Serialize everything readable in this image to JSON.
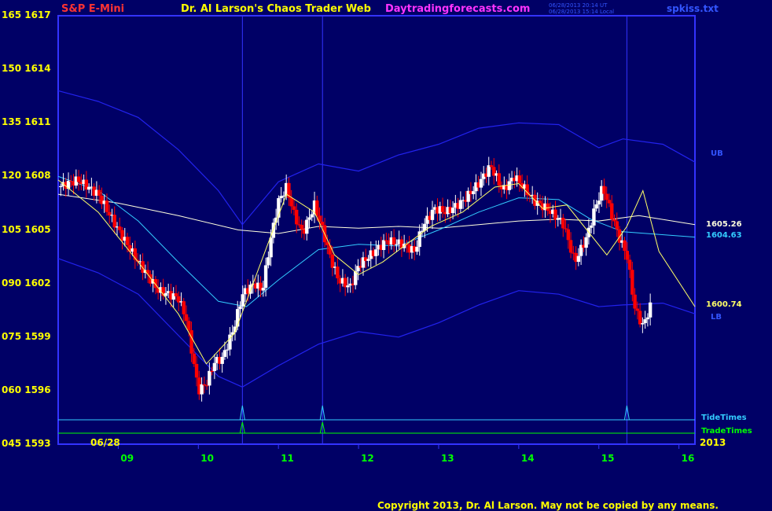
{
  "header": {
    "instrument": "S&P E-Mini",
    "title": "Dr. Al Larson's Chaos Trader Web",
    "site": "Daytradingforecasts.com",
    "timestamp_utc": "06/28/2013 20:14 UT",
    "timestamp_local": "06/28/2013 15:14 Local",
    "filename": "spkiss.txt"
  },
  "footer": {
    "copyright": "Copyright 2013, Dr. Al Larson. May not be copied by any means."
  },
  "colors": {
    "background": "#000066",
    "frame": "#3333ff",
    "up_bar": "#ffffff",
    "down_bar": "#ff0000",
    "band": "#2222ee",
    "cyan_ma": "#33ccff",
    "yellow_ma": "#ffff66",
    "long_ma": "#ffffdd",
    "tide": "#33ccff",
    "trade": "#00ff00"
  },
  "chart_data": {
    "type": "candlestick",
    "ylim": [
      1593,
      1617
    ],
    "y_ticks": [
      {
        "left": "165",
        "right": "1617",
        "value": 1617
      },
      {
        "left": "150",
        "right": "1614",
        "value": 1614
      },
      {
        "left": "135",
        "right": "1611",
        "value": 1611
      },
      {
        "left": "120",
        "right": "1608",
        "value": 1608
      },
      {
        "left": "105",
        "right": "1605",
        "value": 1605
      },
      {
        "left": "090",
        "right": "1602",
        "value": 1602
      },
      {
        "left": "075",
        "right": "1599",
        "value": 1599
      },
      {
        "left": "060",
        "right": "1596",
        "value": 1596
      },
      {
        "left": "045",
        "right": "1593",
        "value": 1593
      }
    ],
    "xlim": [
      8.25,
      16.2
    ],
    "x_ticks": [
      {
        "label": "09",
        "value": 9
      },
      {
        "label": "10",
        "value": 10
      },
      {
        "label": "11",
        "value": 11
      },
      {
        "label": "12",
        "value": 12
      },
      {
        "label": "13",
        "value": 13
      },
      {
        "label": "14",
        "value": 14
      },
      {
        "label": "15",
        "value": 15
      },
      {
        "label": "16",
        "value": 16
      }
    ],
    "date_label": "06/28",
    "year_label": "2013",
    "vertical_lines": [
      10.55,
      11.55,
      15.35
    ],
    "tide_times": [
      10.55,
      11.55,
      15.35
    ],
    "trade_times": [
      10.55,
      11.55
    ],
    "tide_label": "TideTimes",
    "trade_label": "TradeTimes",
    "band_labels": {
      "upper": "UB",
      "lower": "LB"
    },
    "value_labels": [
      {
        "text": "1605.26",
        "value": 1605.26,
        "color": "#ffffdd"
      },
      {
        "text": "1604.63",
        "value": 1604.63,
        "color": "#33ccff"
      },
      {
        "text": "1600.74",
        "value": 1600.74,
        "color": "#ffff66"
      }
    ],
    "series": {
      "close": [
        [
          8.25,
          1607.4
        ],
        [
          8.5,
          1607.8
        ],
        [
          8.75,
          1607.0
        ],
        [
          9.0,
          1605.0
        ],
        [
          9.25,
          1603.2
        ],
        [
          9.5,
          1601.6
        ],
        [
          9.75,
          1601.2
        ],
        [
          9.85,
          1600.0
        ],
        [
          10.0,
          1596.0
        ],
        [
          10.1,
          1596.4
        ],
        [
          10.2,
          1597.6
        ],
        [
          10.3,
          1597.8
        ],
        [
          10.45,
          1599.6
        ],
        [
          10.55,
          1601.4
        ],
        [
          10.7,
          1602.0
        ],
        [
          10.8,
          1601.6
        ],
        [
          10.9,
          1604.4
        ],
        [
          11.0,
          1606.6
        ],
        [
          11.1,
          1607.4
        ],
        [
          11.2,
          1605.8
        ],
        [
          11.3,
          1604.8
        ],
        [
          11.45,
          1606.4
        ],
        [
          11.55,
          1605.0
        ],
        [
          11.65,
          1603.4
        ],
        [
          11.75,
          1602.2
        ],
        [
          11.9,
          1601.8
        ],
        [
          12.0,
          1603.0
        ],
        [
          12.15,
          1603.6
        ],
        [
          12.35,
          1604.4
        ],
        [
          12.55,
          1604.2
        ],
        [
          12.7,
          1603.8
        ],
        [
          12.8,
          1605.2
        ],
        [
          12.95,
          1606.2
        ],
        [
          13.1,
          1606.0
        ],
        [
          13.3,
          1606.6
        ],
        [
          13.5,
          1607.6
        ],
        [
          13.65,
          1608.6
        ],
        [
          13.8,
          1607.2
        ],
        [
          13.95,
          1608.0
        ],
        [
          14.2,
          1606.6
        ],
        [
          14.35,
          1606.2
        ],
        [
          14.55,
          1605.4
        ],
        [
          14.7,
          1603.2
        ],
        [
          14.85,
          1604.6
        ],
        [
          14.95,
          1606.2
        ],
        [
          15.05,
          1607.4
        ],
        [
          15.15,
          1606.0
        ],
        [
          15.25,
          1604.6
        ],
        [
          15.35,
          1603.6
        ],
        [
          15.45,
          1600.6
        ],
        [
          15.55,
          1599.6
        ],
        [
          15.65,
          1600.8
        ]
      ],
      "cyan_ma": [
        [
          8.25,
          1608.0
        ],
        [
          8.75,
          1607.2
        ],
        [
          9.25,
          1605.5
        ],
        [
          9.75,
          1603.2
        ],
        [
          10.25,
          1601.0
        ],
        [
          10.6,
          1600.7
        ],
        [
          11.0,
          1602.2
        ],
        [
          11.5,
          1603.9
        ],
        [
          12.0,
          1604.2
        ],
        [
          12.5,
          1604.1
        ],
        [
          13.0,
          1605.0
        ],
        [
          13.5,
          1606.0
        ],
        [
          14.0,
          1606.8
        ],
        [
          14.5,
          1606.7
        ],
        [
          14.9,
          1605.6
        ],
        [
          15.3,
          1604.9
        ],
        [
          16.2,
          1604.6
        ]
      ],
      "yellow_ma": [
        [
          8.25,
          1607.8
        ],
        [
          8.75,
          1606.0
        ],
        [
          9.25,
          1603.2
        ],
        [
          9.75,
          1600.3
        ],
        [
          10.1,
          1597.5
        ],
        [
          10.45,
          1599.2
        ],
        [
          10.8,
          1603.4
        ],
        [
          11.1,
          1607.0
        ],
        [
          11.45,
          1606.0
        ],
        [
          11.7,
          1603.6
        ],
        [
          12.0,
          1602.5
        ],
        [
          12.3,
          1603.2
        ],
        [
          12.6,
          1604.2
        ],
        [
          12.9,
          1605.2
        ],
        [
          13.3,
          1606.0
        ],
        [
          13.7,
          1607.4
        ],
        [
          14.0,
          1607.6
        ],
        [
          14.3,
          1606.2
        ],
        [
          14.6,
          1606.4
        ],
        [
          14.85,
          1605.0
        ],
        [
          15.1,
          1603.6
        ],
        [
          15.35,
          1605.2
        ],
        [
          15.55,
          1607.2
        ],
        [
          15.75,
          1603.8
        ],
        [
          16.2,
          1600.7
        ]
      ],
      "long_ma": [
        [
          8.25,
          1607.0
        ],
        [
          9.0,
          1606.5
        ],
        [
          9.75,
          1605.8
        ],
        [
          10.5,
          1605.0
        ],
        [
          11.0,
          1604.8
        ],
        [
          11.5,
          1605.2
        ],
        [
          12.0,
          1605.1
        ],
        [
          12.5,
          1605.2
        ],
        [
          13.0,
          1605.1
        ],
        [
          13.5,
          1605.3
        ],
        [
          14.0,
          1605.5
        ],
        [
          14.5,
          1605.6
        ],
        [
          15.0,
          1605.5
        ],
        [
          15.5,
          1605.8
        ],
        [
          16.2,
          1605.3
        ]
      ],
      "upper_band": [
        [
          8.25,
          1612.8
        ],
        [
          8.75,
          1612.2
        ],
        [
          9.25,
          1611.3
        ],
        [
          9.75,
          1609.5
        ],
        [
          10.25,
          1607.2
        ],
        [
          10.55,
          1605.3
        ],
        [
          11.0,
          1607.7
        ],
        [
          11.5,
          1608.7
        ],
        [
          12.0,
          1608.3
        ],
        [
          12.5,
          1609.2
        ],
        [
          13.0,
          1609.8
        ],
        [
          13.5,
          1610.7
        ],
        [
          14.0,
          1611.0
        ],
        [
          14.5,
          1610.9
        ],
        [
          15.0,
          1609.6
        ],
        [
          15.3,
          1610.1
        ],
        [
          15.8,
          1609.8
        ],
        [
          16.2,
          1608.8
        ]
      ],
      "lower_band": [
        [
          8.25,
          1603.4
        ],
        [
          8.75,
          1602.6
        ],
        [
          9.25,
          1601.4
        ],
        [
          9.75,
          1599.1
        ],
        [
          10.25,
          1596.8
        ],
        [
          10.55,
          1596.2
        ],
        [
          11.0,
          1597.4
        ],
        [
          11.5,
          1598.6
        ],
        [
          12.0,
          1599.3
        ],
        [
          12.5,
          1599.0
        ],
        [
          13.0,
          1599.8
        ],
        [
          13.5,
          1600.8
        ],
        [
          14.0,
          1601.6
        ],
        [
          14.5,
          1601.4
        ],
        [
          15.0,
          1600.7
        ],
        [
          15.3,
          1600.8
        ],
        [
          15.8,
          1600.9
        ],
        [
          16.2,
          1600.3
        ]
      ]
    }
  }
}
